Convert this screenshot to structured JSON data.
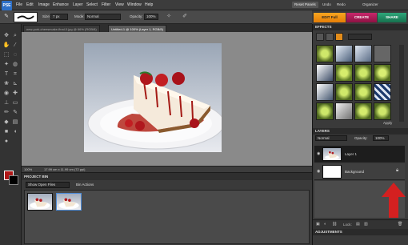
{
  "app": {
    "logo": "PSE"
  },
  "menubar": {
    "items": [
      "File",
      "Edit",
      "Image",
      "Enhance",
      "Layer",
      "Select",
      "Filter",
      "View",
      "Window",
      "Help"
    ],
    "reset_panels": "Reset Panels",
    "undo": "Undo",
    "redo": "Redo",
    "organizer": "Organizer"
  },
  "options": {
    "size_label": "Size:",
    "size_value": "7 px",
    "mode_label": "Mode:",
    "mode_value": "Normal",
    "opacity_label": "Opacity:",
    "opacity_value": "100%"
  },
  "mode_tabs": {
    "edit": "EDIT Full",
    "create": "CREATE",
    "share": "SHARE"
  },
  "colors": {
    "foreground": "#b01818",
    "background": "#000000",
    "edit_accent": "#f7a520",
    "create_accent": "#c8276b",
    "share_accent": "#2ea67a",
    "arrow": "#d42020"
  },
  "documents": {
    "tabs": [
      "new-york-cheesecake-final-0.jpg @ 66% (RGB/8)",
      "Untitled-1 @ 100% (Layer 1, RGB/8)"
    ],
    "active_index": 1,
    "status_zoom": "100%",
    "status_size": "17.99 cm x 11.99 cm (72 ppi)"
  },
  "project_bin": {
    "title": "PROJECT BIN",
    "show_files": "Show Open Files",
    "bin_actions": "Bin Actions"
  },
  "effects": {
    "title": "EFFECTS",
    "apply": "Apply"
  },
  "layers": {
    "title": "LAYERS",
    "blend_mode": "Normal",
    "opacity_label": "Opacity:",
    "opacity_value": "100%",
    "items": [
      {
        "name": "Layer 1"
      },
      {
        "name": "Background"
      }
    ],
    "lock_label": "Lock:"
  },
  "adjustments": {
    "title": "ADJUSTMENTS"
  },
  "icons": [
    "move-icon",
    "zoom-icon",
    "hand-icon",
    "eyedropper-icon",
    "marquee-icon",
    "lasso-icon",
    "magic-wand-icon",
    "type-icon",
    "crop-icon",
    "spot-healing-icon",
    "brush-icon",
    "eraser-icon",
    "paint-bucket-icon",
    "gradient-icon",
    "shape-icon",
    "blur-icon",
    "sponge-icon",
    "eye-icon",
    "lock-icon",
    "trash-icon"
  ]
}
